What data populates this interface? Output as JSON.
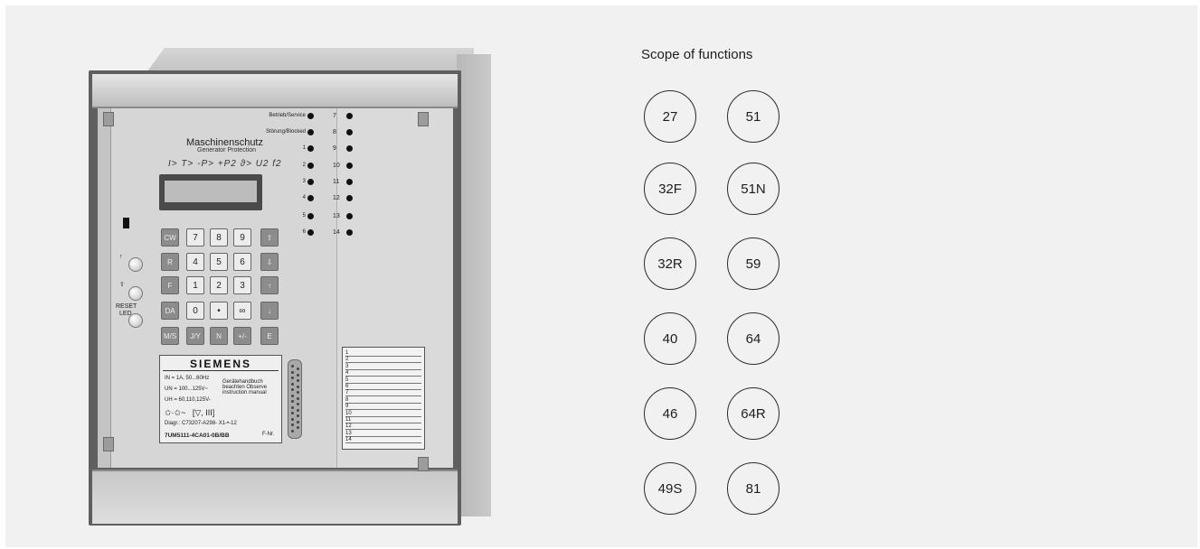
{
  "scope": {
    "title": "Scope of functions",
    "functions": [
      "27",
      "51",
      "32F",
      "51N",
      "32R",
      "59",
      "40",
      "64",
      "46",
      "64R",
      "49S",
      "81"
    ]
  },
  "device": {
    "title_de": "Maschinenschutz",
    "title_en": "Generator Protection",
    "symbols": "I> T> -P> +P2 ϑ> U2 f2",
    "led_labels": [
      "Betrieb/Service",
      "Störung/Blocked",
      "1",
      "2",
      "3",
      "4",
      "5",
      "6"
    ],
    "led_numbers_right": [
      "7",
      "8",
      "9",
      "10",
      "11",
      "12",
      "13",
      "14"
    ],
    "keys": [
      [
        "CW",
        "7",
        "8",
        "9",
        "⇧"
      ],
      [
        "R",
        "4",
        "5",
        "6",
        "⇩"
      ],
      [
        "F",
        "1",
        "2",
        "3",
        "↑"
      ],
      [
        "DA",
        "0",
        "•",
        "∞",
        "↓"
      ],
      [
        "M/S",
        "J/Y",
        "N",
        "+/-",
        "E"
      ]
    ],
    "knob_labels": [
      "↑",
      "⇧",
      "RESET",
      "LED"
    ],
    "nameplate": {
      "brand": "SIEMENS",
      "lines": [
        "IN = 1A, 50...60Hz",
        "UN = 100...125V~",
        "UH = 60,110,125V-",
        "Diagr.: C73207-A298- X1-•-12",
        "7UM5111-4CA01-0B/BB"
      ],
      "note": "Gerätehandbuch beachten Observe instruction manual",
      "suffix": "F-Nr."
    },
    "card_numbers": [
      "1",
      "2",
      "3",
      "4",
      "5",
      "6",
      "7",
      "8",
      "9",
      "10",
      "11",
      "12",
      "13",
      "14"
    ]
  }
}
